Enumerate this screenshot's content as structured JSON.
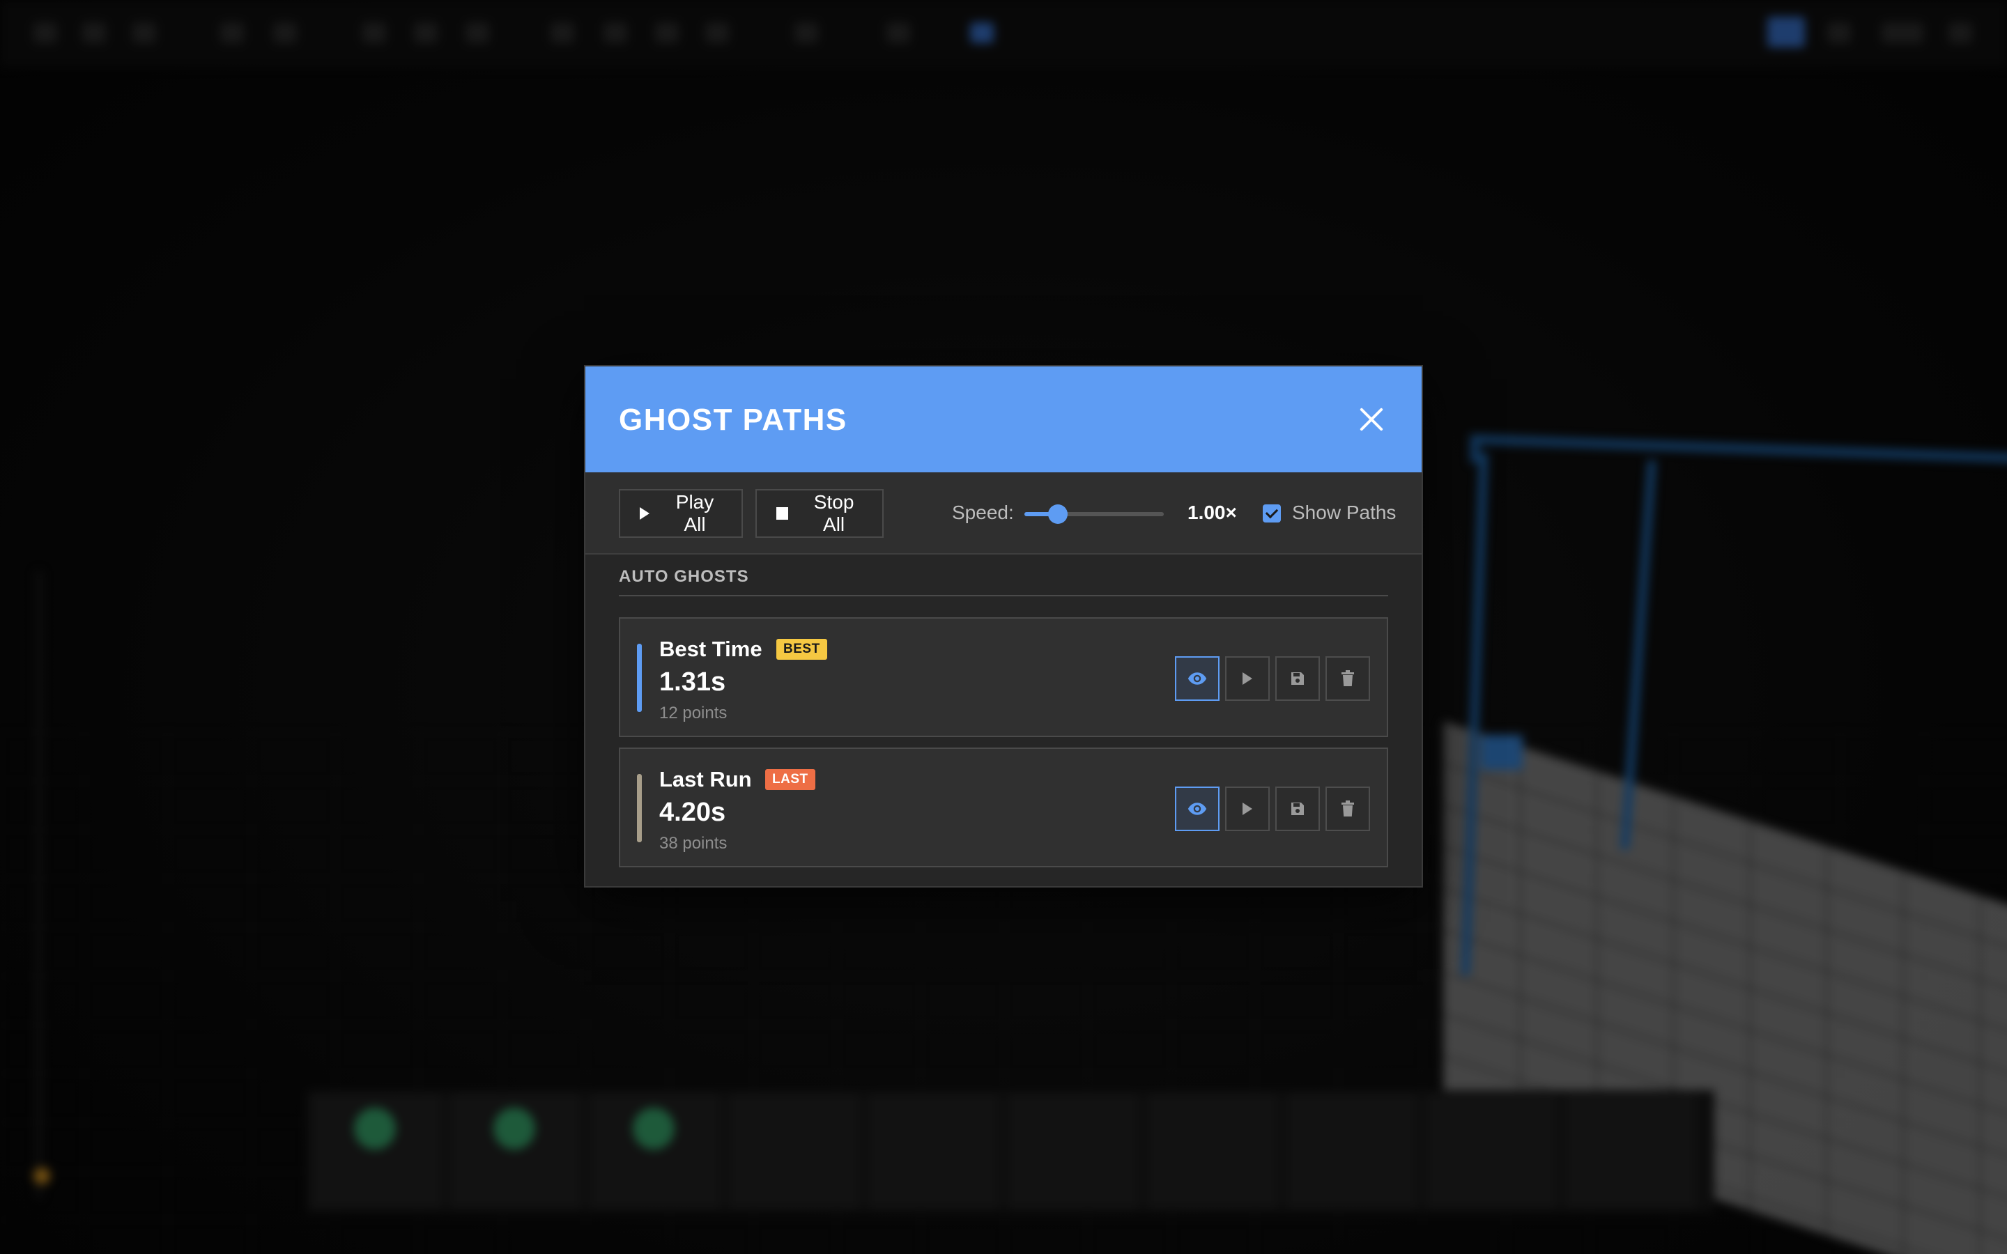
{
  "modal": {
    "title": "GHOST PATHS",
    "close_label": "✕"
  },
  "toolbar": {
    "play_all_label": "Play All",
    "stop_all_label": "Stop All",
    "speed_label": "Speed:",
    "speed_value": "1.00×",
    "speed_slider_fraction": 0.24,
    "show_paths_label": "Show Paths",
    "show_paths_checked": true
  },
  "section": {
    "title": "AUTO GHOSTS"
  },
  "ghosts": [
    {
      "name": "Best Time",
      "badge": "BEST",
      "time": "1.31s",
      "points": "12 points",
      "color": "#5e9cf3",
      "badge_color": "#f5c842"
    },
    {
      "name": "Last Run",
      "badge": "LAST",
      "time": "4.20s",
      "points": "38 points",
      "color": "#a89e8a",
      "badge_color": "#ee6e45"
    }
  ],
  "row_actions": [
    "eye-icon",
    "play-icon",
    "save-icon",
    "trash-icon"
  ],
  "colors": {
    "accent": "#5e9cf3",
    "header": "#5e9cf3"
  }
}
